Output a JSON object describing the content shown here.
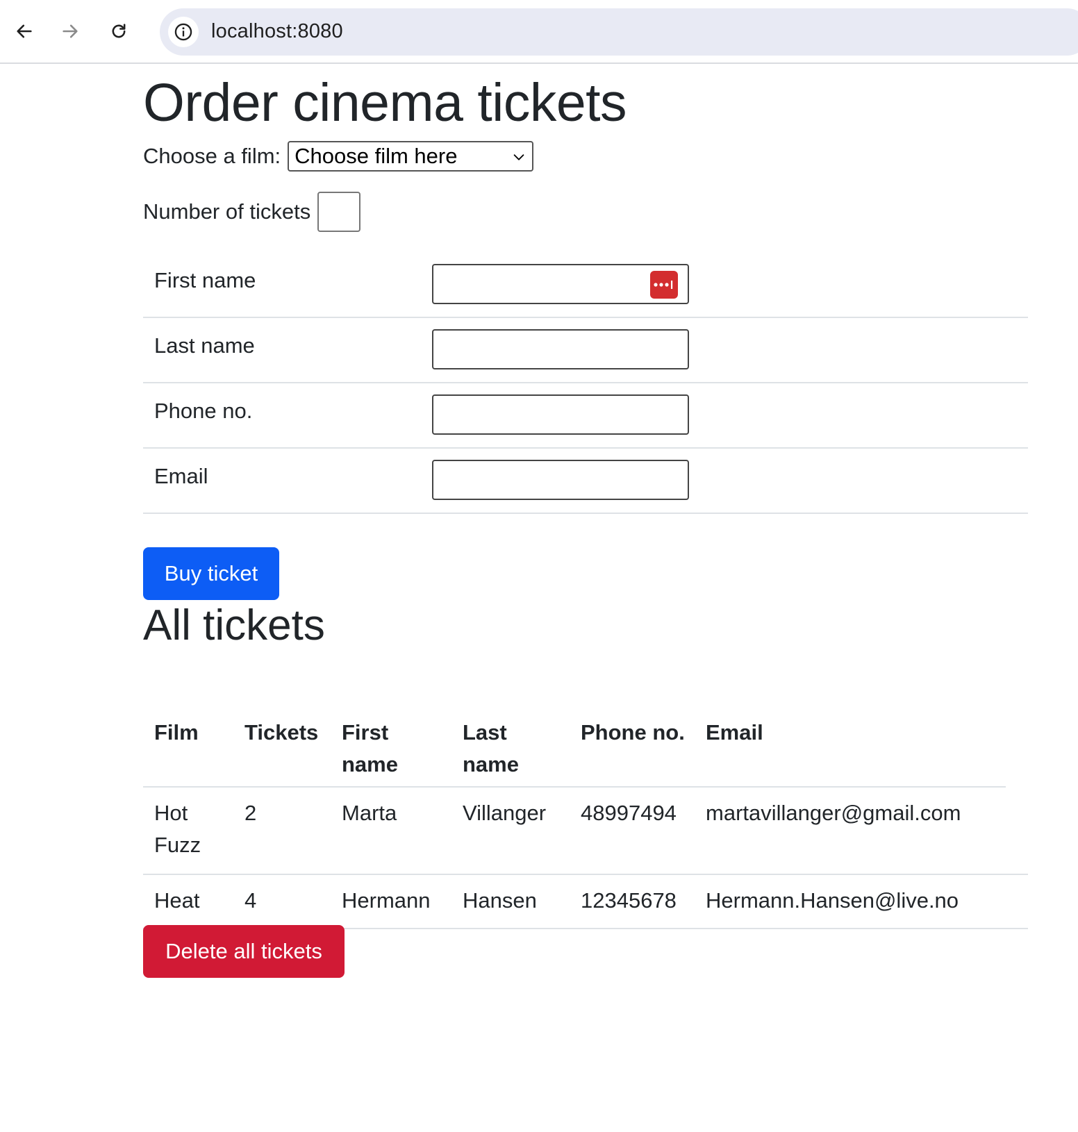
{
  "browser": {
    "url": "localhost:8080",
    "back_icon": "arrow-left-icon",
    "forward_icon": "arrow-right-icon",
    "reload_icon": "reload-icon",
    "site_info_icon": "info-icon"
  },
  "page": {
    "title": "Order cinema tickets",
    "film_label": "Choose a film:",
    "film_select_value": "Choose film here",
    "qty_label": "Number of tickets",
    "qty_value": "",
    "fields": [
      {
        "label": "First name",
        "value": "",
        "has_password_manager_icon": true
      },
      {
        "label": "Last name",
        "value": ""
      },
      {
        "label": "Phone no.",
        "value": ""
      },
      {
        "label": "Email",
        "value": ""
      }
    ],
    "buy_button": "Buy ticket",
    "section_title": "All tickets",
    "table": {
      "headers": [
        "Film",
        "Tickets",
        "First name",
        "Last name",
        "Phone no.",
        "Email"
      ],
      "rows": [
        [
          "Hot Fuzz",
          "2",
          "Marta",
          "Villanger",
          "48997494",
          "martavillanger@gmail.com"
        ],
        [
          "Heat",
          "4",
          "Hermann",
          "Hansen",
          "12345678",
          "Hermann.Hansen@live.no"
        ]
      ]
    },
    "delete_button": "Delete all tickets"
  },
  "colors": {
    "primary": "#0d5df5",
    "danger": "#d11a35",
    "password_manager": "#d32d2f",
    "omnibox": "#e8eaf4"
  }
}
